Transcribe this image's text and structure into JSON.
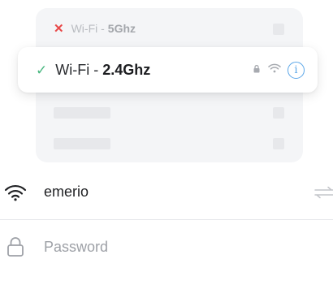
{
  "networks": {
    "other": {
      "status_icon": "x-icon",
      "prefix": "Wi-Fi -",
      "band": "5Ghz"
    },
    "active": {
      "status_icon": "check-icon",
      "prefix": "Wi-Fi -",
      "band": "2.4Ghz",
      "info_glyph": "i"
    }
  },
  "form": {
    "network_name": "emerio",
    "password_placeholder": "Password",
    "password_value": ""
  },
  "colors": {
    "error": "#e84848",
    "success": "#48b77f",
    "info": "#5aa6e8",
    "text": "#1f2023",
    "placeholder": "#9ea1a7"
  },
  "icons": [
    "x-icon",
    "check-icon",
    "lock-icon",
    "wifi-icon",
    "info-icon",
    "swap-icon"
  ]
}
